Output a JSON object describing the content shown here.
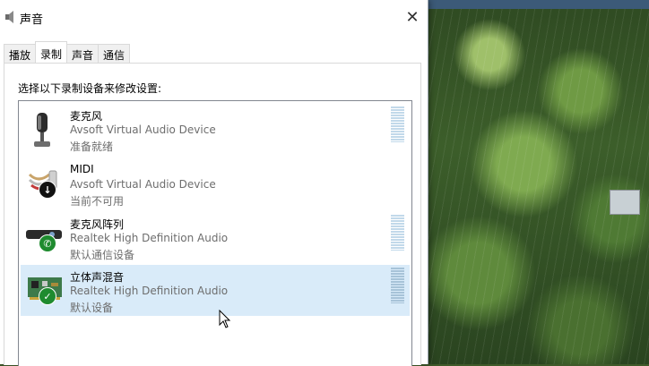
{
  "window": {
    "title": "声音",
    "close_glyph": "✕"
  },
  "tabs": [
    {
      "label": "播放",
      "active": false
    },
    {
      "label": "录制",
      "active": true
    },
    {
      "label": "声音",
      "active": false
    },
    {
      "label": "通信",
      "active": false
    }
  ],
  "panel": {
    "instruction": "选择以下录制设备来修改设置:"
  },
  "devices": [
    {
      "name": "麦克风",
      "driver": "Avsoft Virtual Audio Device",
      "status": "准备就绪",
      "icon": "microphone-icon",
      "badge": null
    },
    {
      "name": "MIDI",
      "driver": "Avsoft Virtual Audio Device",
      "status": "当前不可用",
      "icon": "midi-cable-icon",
      "badge": "down-arrow"
    },
    {
      "name": "麦克风阵列",
      "driver": "Realtek High Definition Audio",
      "status": "默认通信设备",
      "icon": "mic-array-icon",
      "badge": "phone"
    },
    {
      "name": "立体声混音",
      "driver": "Realtek High Definition Audio",
      "status": "默认设备",
      "icon": "sound-card-icon",
      "badge": "checkmark",
      "selected": true
    }
  ],
  "colors": {
    "selection": "#d9ebf9",
    "badge_green": "#1f8b2f"
  }
}
